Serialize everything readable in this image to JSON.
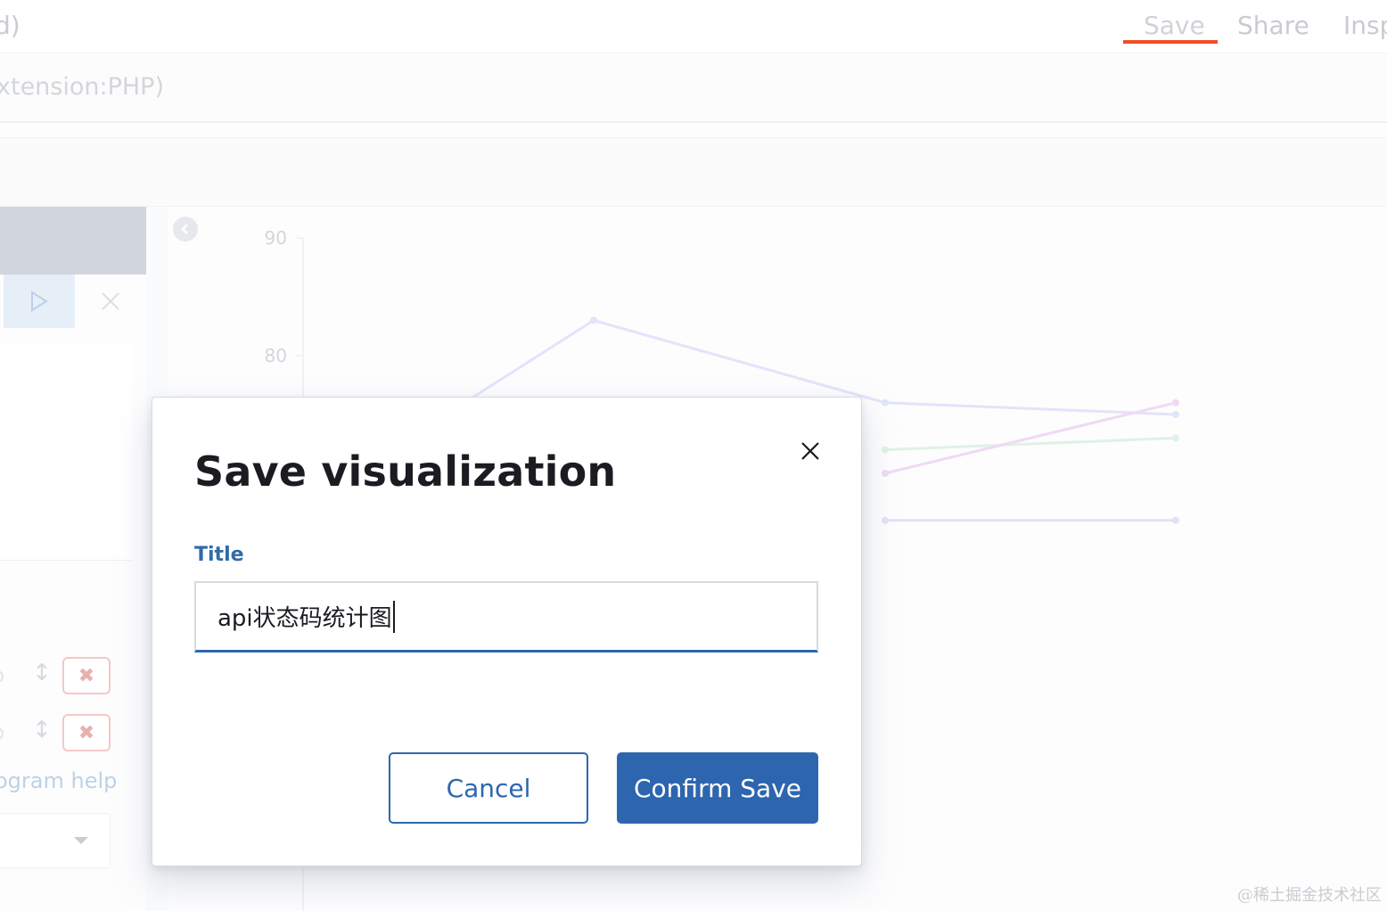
{
  "topbar": {
    "app_title_fragment": "d)",
    "menu": [
      {
        "label": "Save",
        "active": true
      },
      {
        "label": "Share",
        "active": false
      },
      {
        "label": "Insp",
        "active": false
      }
    ]
  },
  "query": {
    "text_fragment": "xtension:PHP)"
  },
  "sidebar": {
    "help_link": "ogram help"
  },
  "chart_data": {
    "type": "line",
    "y_ticks": [
      "90",
      "80"
    ],
    "ylim": [
      65,
      92
    ],
    "x": [
      1,
      2,
      3,
      4
    ],
    "series": [
      {
        "values": [
          72,
          83,
          76,
          75
        ],
        "color": "#e2e4fa"
      },
      {
        "values": [
          null,
          null,
          72,
          73
        ],
        "color": "#dff2e4"
      },
      {
        "values": [
          null,
          null,
          70,
          76
        ],
        "color": "#efdaf4"
      },
      {
        "values": [
          null,
          null,
          66,
          66
        ],
        "color": "#e4e0f4"
      }
    ],
    "grid": false,
    "legend": "none"
  },
  "modal": {
    "title": "Save visualization",
    "field_label": "Title",
    "input_value": "api状态码统计图",
    "cancel_label": "Cancel",
    "confirm_label": "Confirm Save"
  },
  "watermark": "@稀土掘金技术社区",
  "colors": {
    "primary": "#2d66ae",
    "accent_underline": "#f04e23",
    "label_blue": "#2f6ba9"
  }
}
